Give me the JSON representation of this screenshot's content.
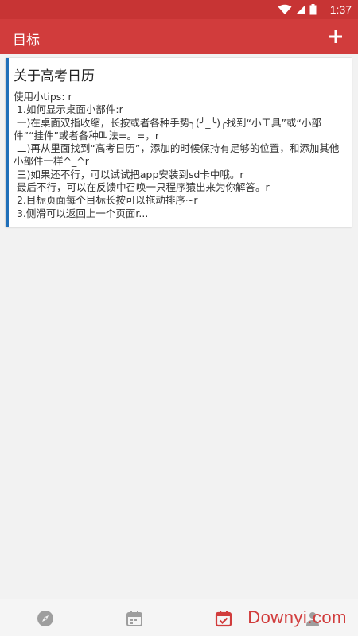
{
  "statusbar": {
    "time": "1:37"
  },
  "appbar": {
    "title": "目标",
    "add_icon": "plus-icon"
  },
  "card": {
    "title": "关于高考日历",
    "body": "使用小tips: r\n 1.如何显示桌面小部件:r\n 一)在桌面双指收缩，长按或者各种手势╮(╯_╰)╭找到“小工具”或“小部件”“挂件”或者各种叫法=。=，r\n 二)再从里面找到“高考日历”，添加的时候保持有足够的位置，和添加其他小部件一样^_^r\n 三)如果还不行，可以试试把app安装到sd卡中哦。r\n 最后不行，可以在反馈中召唤一只程序猿出来为你解答。r\n 2.目标页面每个目标长按可以拖动排序~r\n 3.侧滑可以返回上一个页面r..."
  },
  "bottomnav": {
    "items": [
      {
        "icon": "compass-icon"
      },
      {
        "icon": "calendar-icon"
      },
      {
        "icon": "calendar-check-icon"
      },
      {
        "icon": "person-icon"
      }
    ],
    "watermark": "Downyi.com"
  },
  "colors": {
    "statusbar": "#c73434",
    "appbar": "#d13c3c",
    "card_accent": "#1f6fb9"
  }
}
